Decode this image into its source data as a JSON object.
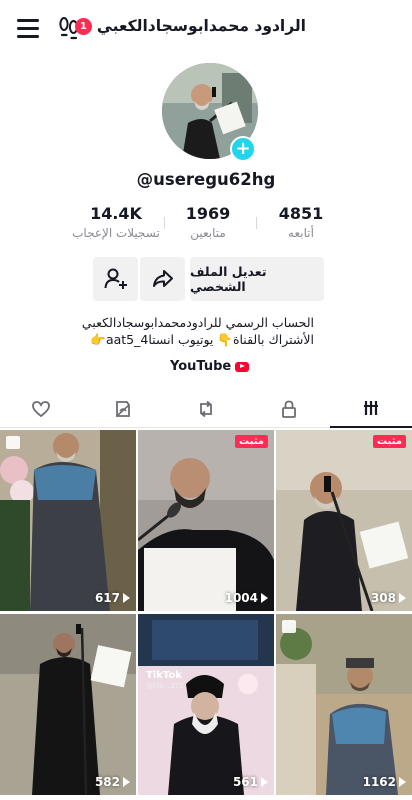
{
  "header": {
    "title": "الرادود محمدابوسجادالكعبي",
    "notification_count": "1",
    "menu_icon": "hamburger-menu-icon",
    "footprint_icon": "footprints-icon"
  },
  "profile": {
    "username": "@useregu62hg",
    "avatar_icon": "avatar-photo",
    "add_icon": "plus-icon"
  },
  "stats": {
    "likes_value": "14.4K",
    "likes_label": "تسجيلات الإعجاب",
    "followers_value": "1969",
    "followers_label": "متابعين",
    "following_value": "4851",
    "following_label": "أتابعه"
  },
  "actions": {
    "edit_profile_label": "تعديل الملف الشخصي",
    "share_icon": "share-arrow-icon",
    "add_friend_icon": "add-friend-icon"
  },
  "bio": {
    "line1": "الحساب الرسمي للرادودمحمدابوسجادالكعبي",
    "line2": "الأشتراك بالقناة👇 يوتيوب انستا4_aat5👉",
    "link_label": "YouTube"
  },
  "tabs": [
    {
      "name": "videos",
      "icon": "grid-bars-icon",
      "active": true
    },
    {
      "name": "private",
      "icon": "lock-icon",
      "active": false
    },
    {
      "name": "reposts",
      "icon": "repost-icon",
      "active": false
    },
    {
      "name": "favorites",
      "icon": "hidden-eye-icon",
      "active": false
    },
    {
      "name": "liked",
      "icon": "heart-icon",
      "active": false
    }
  ],
  "videos": [
    {
      "views": "308",
      "pinned": true,
      "pinned_label": "مثبت"
    },
    {
      "views": "1004",
      "pinned": true,
      "pinned_label": "مثبت"
    },
    {
      "views": "617",
      "pinned": false,
      "photo": true
    },
    {
      "views": "1162",
      "pinned": false,
      "photo": true
    },
    {
      "views": "561",
      "pinned": false,
      "tiktok_label": "TikTok",
      "tiktok_sub": "@ida...315"
    },
    {
      "views": "582",
      "pinned": false
    }
  ]
}
